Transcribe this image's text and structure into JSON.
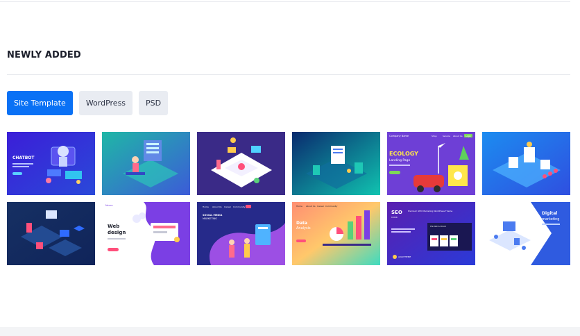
{
  "section": {
    "title": "NEWLY ADDED"
  },
  "tabs": [
    {
      "label": "Site Template",
      "active": true
    },
    {
      "label": "WordPress",
      "active": false
    },
    {
      "label": "PSD",
      "active": false
    }
  ],
  "thumbnails": {
    "t1": {
      "title": "CHATBOT"
    },
    "t5": {
      "brand": "Company Name",
      "nav": [
        "Shop",
        "Service",
        "About Us",
        "Login"
      ],
      "title": "ECOLOGY",
      "subtitle": "Landing Page"
    },
    "t8": {
      "brand": "Neuro",
      "title": "Web",
      "title2": "design"
    },
    "t10": {
      "nav": [
        "Home",
        "About Us",
        "Career",
        "Community"
      ],
      "heading": "SOCIAL MEDIA",
      "subheading": "MARKETING"
    },
    "t11": {
      "nav": [
        "Home",
        "About Us",
        "Career",
        "Community"
      ],
      "title": "Data",
      "title2": "Analysis"
    },
    "t12": {
      "title": "SEO",
      "title2": "COOK",
      "headline": "Premium SEO Marketing WordPress Theme",
      "tagline": "It's Not A Droid",
      "footer": "AVAXTHEME"
    },
    "t13": {
      "title": "Digital",
      "title2": "marketing"
    }
  },
  "colors": {
    "accent": "#0a71f5",
    "tab_bg": "#e9ecf2",
    "text": "#1c1f2b"
  }
}
